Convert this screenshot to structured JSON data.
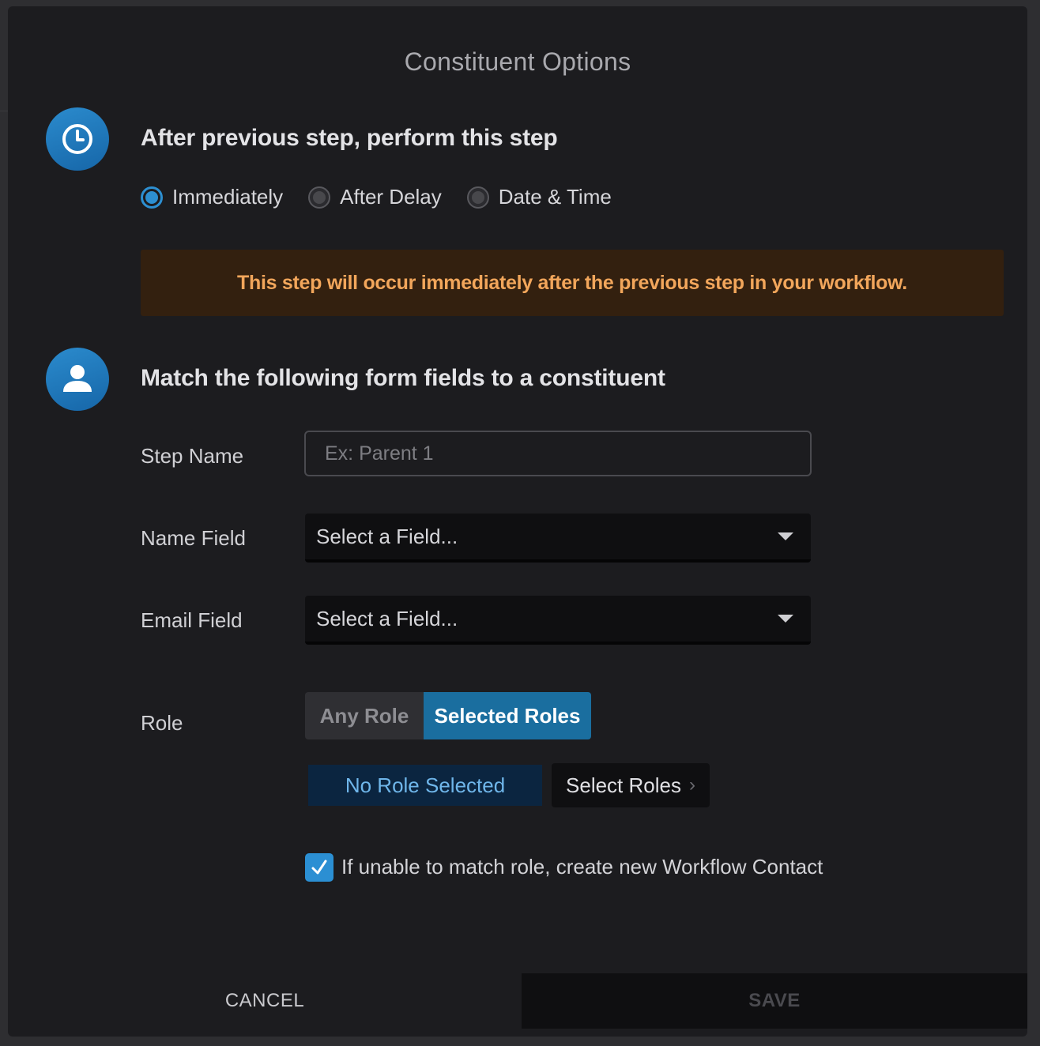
{
  "modal": {
    "title": "Constituent Options"
  },
  "timing": {
    "heading": "After previous step, perform this step",
    "icon": "clock-icon",
    "options": [
      {
        "label": "Immediately",
        "checked": true
      },
      {
        "label": "After Delay",
        "checked": false
      },
      {
        "label": "Date & Time",
        "checked": false
      }
    ],
    "notice": "This step will occur immediately after the previous step in your workflow."
  },
  "match": {
    "heading": "Match the following form fields to a constituent",
    "icon": "user-icon",
    "step_name": {
      "label": "Step Name",
      "placeholder": "Ex: Parent 1",
      "value": ""
    },
    "name_field": {
      "label": "Name Field",
      "value": "Select a Field..."
    },
    "email_field": {
      "label": "Email Field",
      "value": "Select a Field..."
    },
    "role": {
      "label": "Role",
      "options": [
        "Any Role",
        "Selected Roles"
      ],
      "selected": "Selected Roles",
      "badge": "No Role Selected",
      "select_button": "Select Roles"
    },
    "create_contact": {
      "label": "If unable to match role, create new Workflow Contact",
      "checked": true
    }
  },
  "footer": {
    "cancel": "CANCEL",
    "save": "SAVE"
  },
  "colors": {
    "accent": "#2d8fd1",
    "segment_selected": "#1a6e9f",
    "notice_bg": "#33200f",
    "notice_text": "#f2a65b",
    "modal_bg": "#1c1c1f"
  }
}
